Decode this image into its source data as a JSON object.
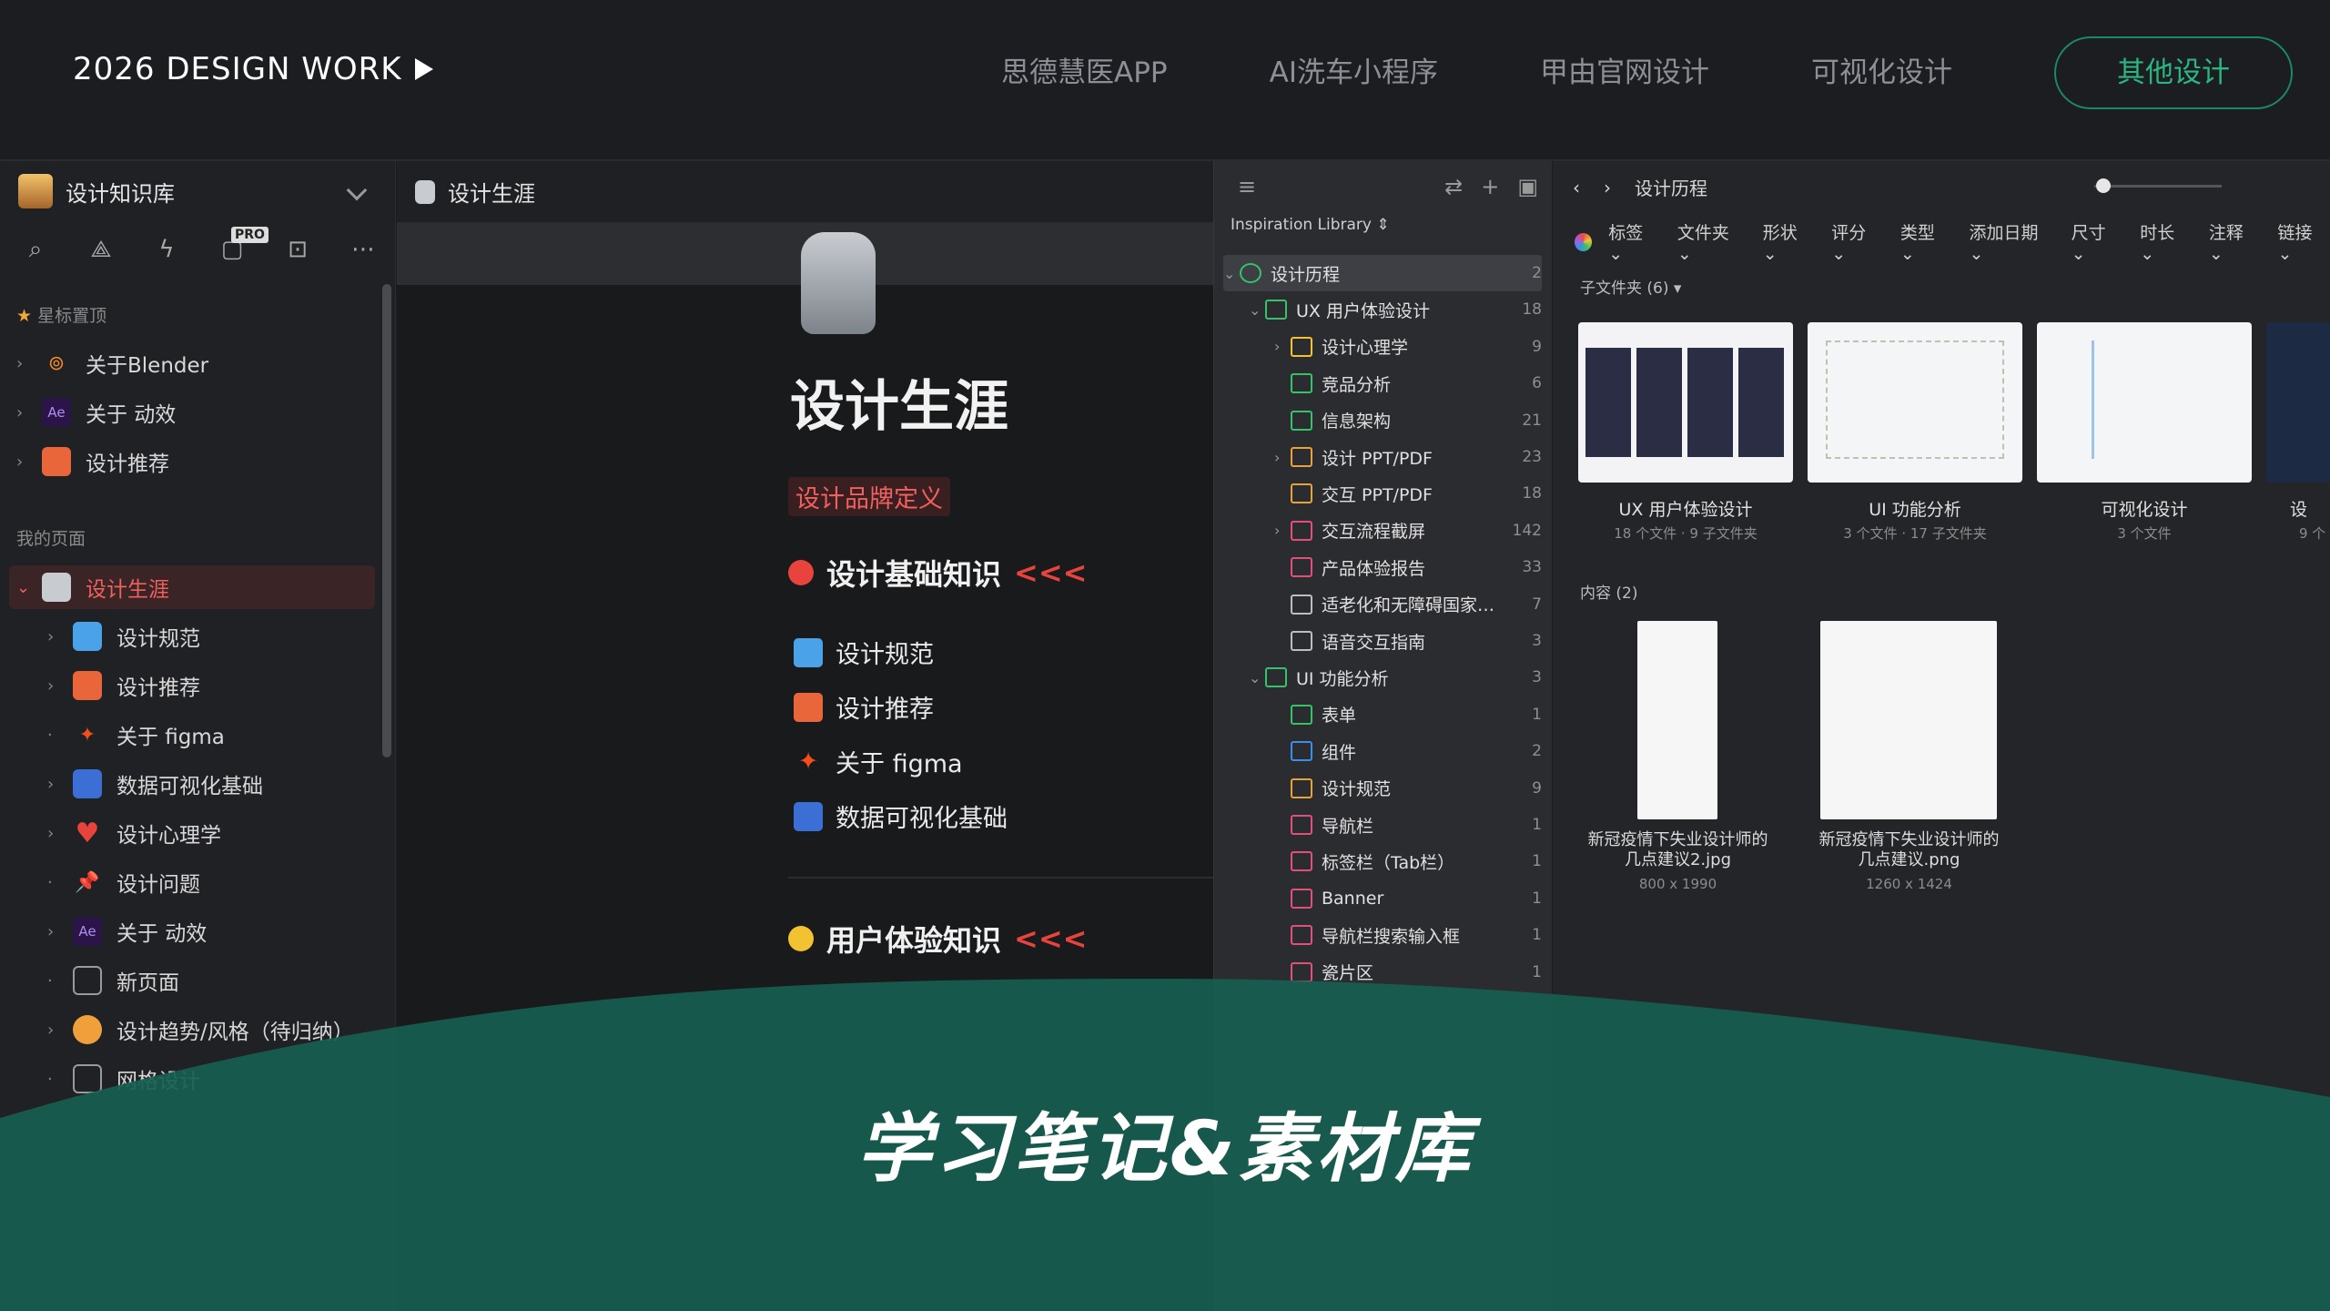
{
  "header": {
    "brand": "2026 DESIGN WORK",
    "nav": [
      "思德慧医APP",
      "AI洗车小程序",
      "甲由官网设计",
      "可视化设计"
    ],
    "active": "其他设计"
  },
  "left": {
    "workspace": "设计知识库",
    "pro_badge": "PRO",
    "starred_label": "星标置顶",
    "starred": [
      "关于Blender",
      "关于 动效",
      "设计推荐"
    ],
    "my_pages_label": "我的页面",
    "selected": "设计生涯",
    "pages": [
      "设计规范",
      "设计推荐",
      "关于 figma",
      "数据可视化基础",
      "设计心理学",
      "设计问题",
      "关于 动效",
      "新页面",
      "设计趋势/风格（待归纳）",
      "网格设计"
    ]
  },
  "doc": {
    "tab_title": "设计生涯",
    "title": "设计生涯",
    "tag": "设计品牌定义",
    "section1": "设计基础知识",
    "arrows": "<<<",
    "links": [
      "设计规范",
      "设计推荐",
      "关于 figma",
      "数据可视化基础"
    ],
    "section2": "用户体验知识"
  },
  "tree": {
    "library": "Inspiration Library",
    "root": {
      "label": "设计历程",
      "count": "2"
    },
    "items": [
      {
        "label": "UX 用户体验设计",
        "count": "18"
      },
      {
        "label": "设计心理学",
        "count": "9"
      },
      {
        "label": "竞品分析",
        "count": "6"
      },
      {
        "label": "信息架构",
        "count": "21"
      },
      {
        "label": "设计 PPT/PDF",
        "count": "23"
      },
      {
        "label": "交互 PPT/PDF",
        "count": "18"
      },
      {
        "label": "交互流程截屏",
        "count": "142"
      },
      {
        "label": "产品体验报告",
        "count": "33"
      },
      {
        "label": "适老化和无障碍国家…",
        "count": "7"
      },
      {
        "label": "语音交互指南",
        "count": "3"
      },
      {
        "label": "UI 功能分析",
        "count": "3"
      },
      {
        "label": "表单",
        "count": "1"
      },
      {
        "label": "组件",
        "count": "2"
      },
      {
        "label": "设计规范",
        "count": "9"
      },
      {
        "label": "导航栏",
        "count": "1"
      },
      {
        "label": "标签栏（Tab栏）",
        "count": "1"
      },
      {
        "label": "Banner",
        "count": "1"
      },
      {
        "label": "导航栏搜索输入框",
        "count": "1"
      },
      {
        "label": "瓷片区",
        "count": "1"
      }
    ]
  },
  "gallery": {
    "breadcrumb": "设计历程",
    "filters": [
      "标签",
      "文件夹",
      "形状",
      "评分",
      "类型",
      "添加日期",
      "尺寸",
      "时长",
      "注释",
      "链接"
    ],
    "subfolders_label": "子文件夹 (6)",
    "folders": [
      {
        "name": "UX 用户体验设计",
        "meta": "18 个文件 · 9 子文件夹"
      },
      {
        "name": "UI 功能分析",
        "meta": "3 个文件 · 17 子文件夹"
      },
      {
        "name": "可视化设计",
        "meta": "3 个文件"
      },
      {
        "name": "设",
        "meta": "9 个"
      }
    ],
    "content_label": "内容 (2)",
    "files": [
      {
        "name": "新冠疫情下失业设计师的几点建议2.jpg",
        "size": "800 x 1990"
      },
      {
        "name": "新冠疫情下失业设计师的几点建议.png",
        "size": "1260 x 1424"
      }
    ]
  },
  "banner": {
    "title": "学习笔记&素材库",
    "color": "#175e50"
  }
}
